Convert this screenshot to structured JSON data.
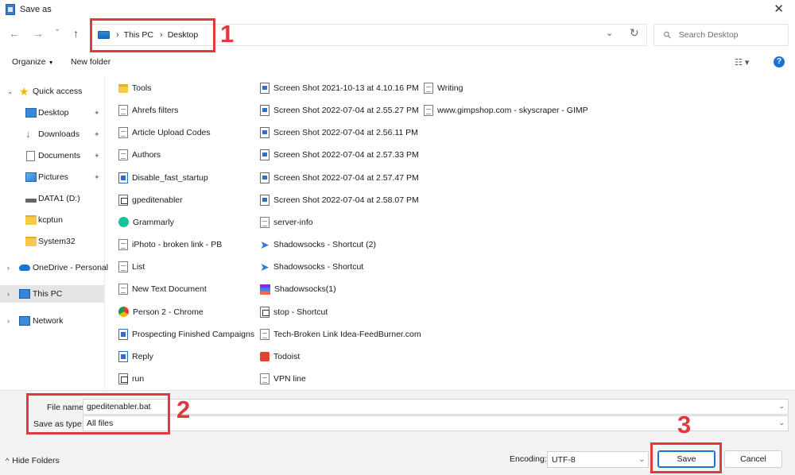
{
  "window": {
    "title": "Save as",
    "close": "✕"
  },
  "nav": {
    "back": "←",
    "forward": "→",
    "recent": "⌄",
    "up": "↑",
    "breadcrumbs": [
      "This PC",
      "Desktop"
    ],
    "crumb_sep": "›",
    "dropdown": "⌄",
    "refresh": "↻",
    "search_placeholder": "Search Desktop"
  },
  "toolbar": {
    "organize": "Organize",
    "new_folder": "New folder",
    "view": "☷ ▾",
    "help": "?"
  },
  "sidebar": {
    "items": [
      {
        "label": "Quick access",
        "chevron": "⌄",
        "icon": "star"
      },
      {
        "label": "Desktop",
        "icon": "desktop",
        "pinned": true
      },
      {
        "label": "Downloads",
        "icon": "download",
        "pinned": true
      },
      {
        "label": "Documents",
        "icon": "document",
        "pinned": true
      },
      {
        "label": "Pictures",
        "icon": "pictures",
        "pinned": true
      },
      {
        "label": "DATA1 (D:)",
        "icon": "drive"
      },
      {
        "label": "kcptun",
        "icon": "folder"
      },
      {
        "label": "System32",
        "icon": "folder"
      },
      {
        "label": "OneDrive - Personal",
        "chevron": "›",
        "icon": "cloud"
      },
      {
        "label": "This PC",
        "chevron": "›",
        "icon": "pc",
        "selected": true
      },
      {
        "label": "Network",
        "chevron": "›",
        "icon": "network"
      }
    ],
    "pin_glyph": "📌"
  },
  "files": {
    "col1": [
      {
        "name": "Tools",
        "icon": "folder"
      },
      {
        "name": "Ahrefs filters",
        "icon": "text"
      },
      {
        "name": "Article Upload Codes",
        "icon": "text"
      },
      {
        "name": "Authors",
        "icon": "text"
      },
      {
        "name": "Disable_fast_startup",
        "icon": "blueapp"
      },
      {
        "name": "gpeditenabler",
        "icon": "bat"
      },
      {
        "name": "Grammarly",
        "icon": "grammarly"
      },
      {
        "name": "iPhoto - broken link - PB",
        "icon": "text"
      },
      {
        "name": "List",
        "icon": "text"
      },
      {
        "name": "New Text Document",
        "icon": "text"
      },
      {
        "name": "Person 2 - Chrome",
        "icon": "chrome"
      },
      {
        "name": "Prospecting Finished Campaigns",
        "icon": "blueapp"
      },
      {
        "name": "Reply",
        "icon": "blueapp"
      },
      {
        "name": "run",
        "icon": "bat"
      }
    ],
    "col2": [
      {
        "name": "Screen Shot 2021-10-13 at 4.10.16 PM",
        "icon": "shot"
      },
      {
        "name": "Screen Shot 2022-07-04 at 2.55.27 PM",
        "icon": "shot"
      },
      {
        "name": "Screen Shot 2022-07-04 at 2.56.11 PM",
        "icon": "shot"
      },
      {
        "name": "Screen Shot 2022-07-04 at 2.57.33 PM",
        "icon": "shot"
      },
      {
        "name": "Screen Shot 2022-07-04 at 2.57.47 PM",
        "icon": "shot"
      },
      {
        "name": "Screen Shot 2022-07-04 at 2.58.07 PM",
        "icon": "shot"
      },
      {
        "name": "server-info",
        "icon": "text"
      },
      {
        "name": "Shadowsocks - Shortcut (2)",
        "icon": "shadowsocks"
      },
      {
        "name": "Shadowsocks - Shortcut",
        "icon": "shadowsocks"
      },
      {
        "name": "Shadowsocks(1)",
        "icon": "rar"
      },
      {
        "name": "stop - Shortcut",
        "icon": "bat"
      },
      {
        "name": "Tech-Broken Link Idea-FeedBurner.com",
        "icon": "text"
      },
      {
        "name": "Todoist",
        "icon": "todoist"
      },
      {
        "name": "VPN line",
        "icon": "text"
      }
    ],
    "col3": [
      {
        "name": "Writing",
        "icon": "text"
      },
      {
        "name": "www.gimpshop.com - skyscraper - GIMP",
        "icon": "text"
      }
    ]
  },
  "form": {
    "file_name_label": "File name:",
    "file_name_value": "gpeditenabler.bat",
    "save_type_label": "Save as type:",
    "save_type_value": "All files",
    "dropdown": "⌄"
  },
  "footer": {
    "hide_folders": "Hide Folders",
    "hide_caret": "^",
    "encoding_label": "Encoding:",
    "encoding_value": "UTF-8",
    "save": "Save",
    "cancel": "Cancel"
  },
  "callouts": [
    "1",
    "2",
    "3"
  ],
  "colors": {
    "callout": "#e0393e",
    "accent": "#1a73d1"
  }
}
